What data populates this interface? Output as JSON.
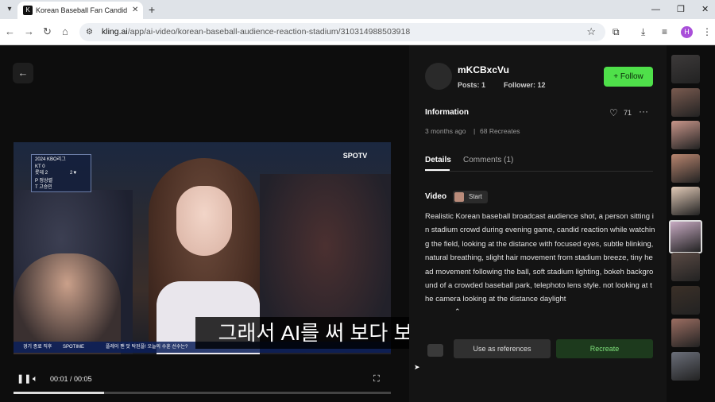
{
  "browser": {
    "tab_title": "Korean Baseball Fan Candid",
    "tab_favicon": "K",
    "url_domain": "kling.ai",
    "url_path": "/app/ai-video/korean-baseball-audience-reaction-stadium/310314988503918",
    "profile_initial": "H"
  },
  "video": {
    "time_current": "00:01",
    "time_total": "00:05",
    "progress": 0.24,
    "subtitle": "그래서 AI를 써 보다 보면 느끼는",
    "scoreboard": [
      "2024 KBO리그",
      "KT  0",
      "롯데  2",
      "2▼",
      "P 정상렬",
      "T 고승민"
    ],
    "broadcast_logo": "SPOTV",
    "ticker": [
      "경기 종료 직후",
      "SPOTIME",
      "플레이 팬 맛 탁된플! 오늘의 수훈 선수는?"
    ]
  },
  "panel": {
    "username": "mKCBxcVu",
    "posts_label": "Posts: 1",
    "follower_label": "Follower: 12",
    "follow_button": "Follow",
    "info_title": "Information",
    "likes": "71",
    "time_ago": "3 months ago",
    "recreates": "68 Recreates",
    "tab_details": "Details",
    "tab_comments": "Comments (1)",
    "video_label": "Video",
    "start_label": "Start",
    "description": "Realistic Korean baseball broadcast audience shot, a person sitting in stadium crowd during evening game, candid reaction while watching the field, looking at the distance with focused eyes, subtle blinking, natural breathing, slight hair movement from stadium breeze, tiny head movement following the ball, soft stadium lighting, bokeh background of a crowded baseball park, telephoto lens style. not looking at the camera looking at the distance daylight",
    "use_ref_button": "Use as references",
    "recreate_button": "Recreate"
  },
  "colors": {
    "accent_green": "#4fe04a",
    "profile_purple": "#a94fd9"
  },
  "thumbnails": [
    "#3d3a3a",
    "#7a5b50",
    "#c9968a",
    "#b8856f",
    "#e2cbb8",
    "#c7aac2",
    "#5a4a44",
    "#3b3028",
    "#9c6e62",
    "#6b6f7a"
  ]
}
